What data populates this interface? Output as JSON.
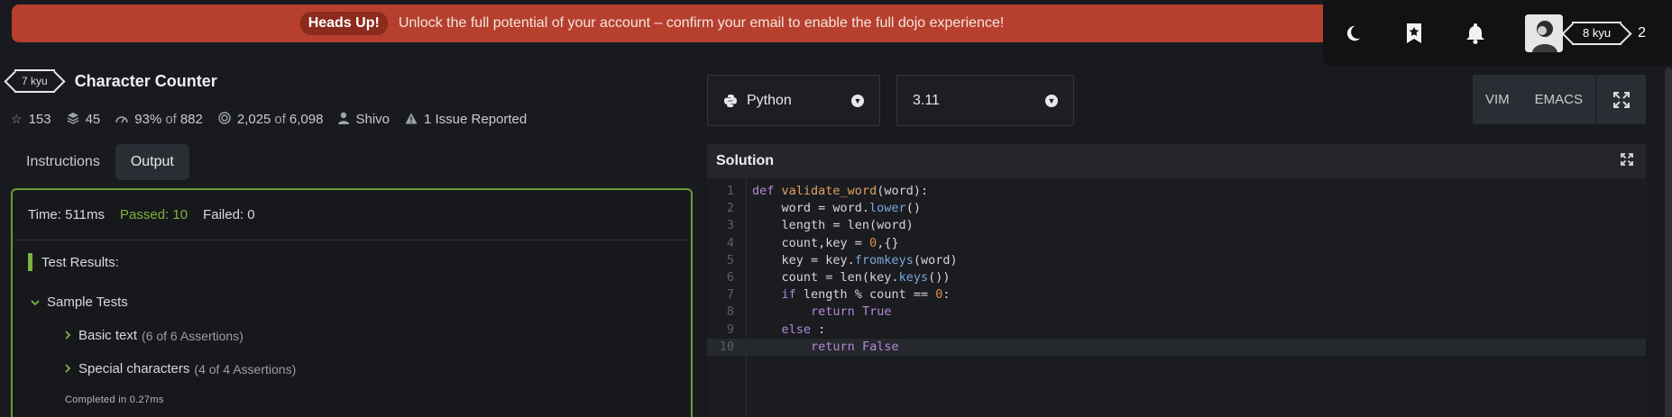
{
  "banner": {
    "badge": "Heads Up!",
    "message": "Unlock the full potential of your account – confirm your email to enable the full dojo experience!"
  },
  "topnav": {
    "rank": "8 kyu",
    "honor": "2"
  },
  "kata": {
    "rank": "7 kyu",
    "title": "Character Counter",
    "stats": {
      "stars": "153",
      "collections": "45",
      "satisfaction": "93%",
      "satisfaction_of": "of",
      "satisfaction_total": "882",
      "completed": "2,025",
      "completed_of": "of",
      "completed_total": "6,098",
      "author": "Shivo",
      "issues": "1 Issue Reported"
    }
  },
  "tabs": [
    {
      "label": "Instructions"
    },
    {
      "label": "Output"
    }
  ],
  "output": {
    "time": "Time: 511ms",
    "passed": "Passed: 10",
    "failed": "Failed: 0",
    "results_title": "Test Results:",
    "group": "Sample Tests",
    "items": [
      {
        "name": "Basic text",
        "assertions": "(6 of 6 Assertions)"
      },
      {
        "name": "Special characters",
        "assertions": "(4 of 4 Assertions)"
      }
    ],
    "completed": "Completed in 0.27ms"
  },
  "editor": {
    "language": "Python",
    "version": "3.11",
    "modes": [
      "VIM",
      "EMACS"
    ],
    "solution_title": "Solution"
  },
  "code": [
    "def validate_word(word):",
    "    word = word.lower()",
    "    length = len(word)",
    "    count,key = 0,{}",
    "    key = key.fromkeys(word)",
    "    count = len(key.keys())",
    "    if length % count == 0:",
    "        return True",
    "    else :",
    "        return False"
  ],
  "colors": {
    "banner": "#b6402d",
    "accent_green": "#7eb33e",
    "background": "#181a1f"
  }
}
